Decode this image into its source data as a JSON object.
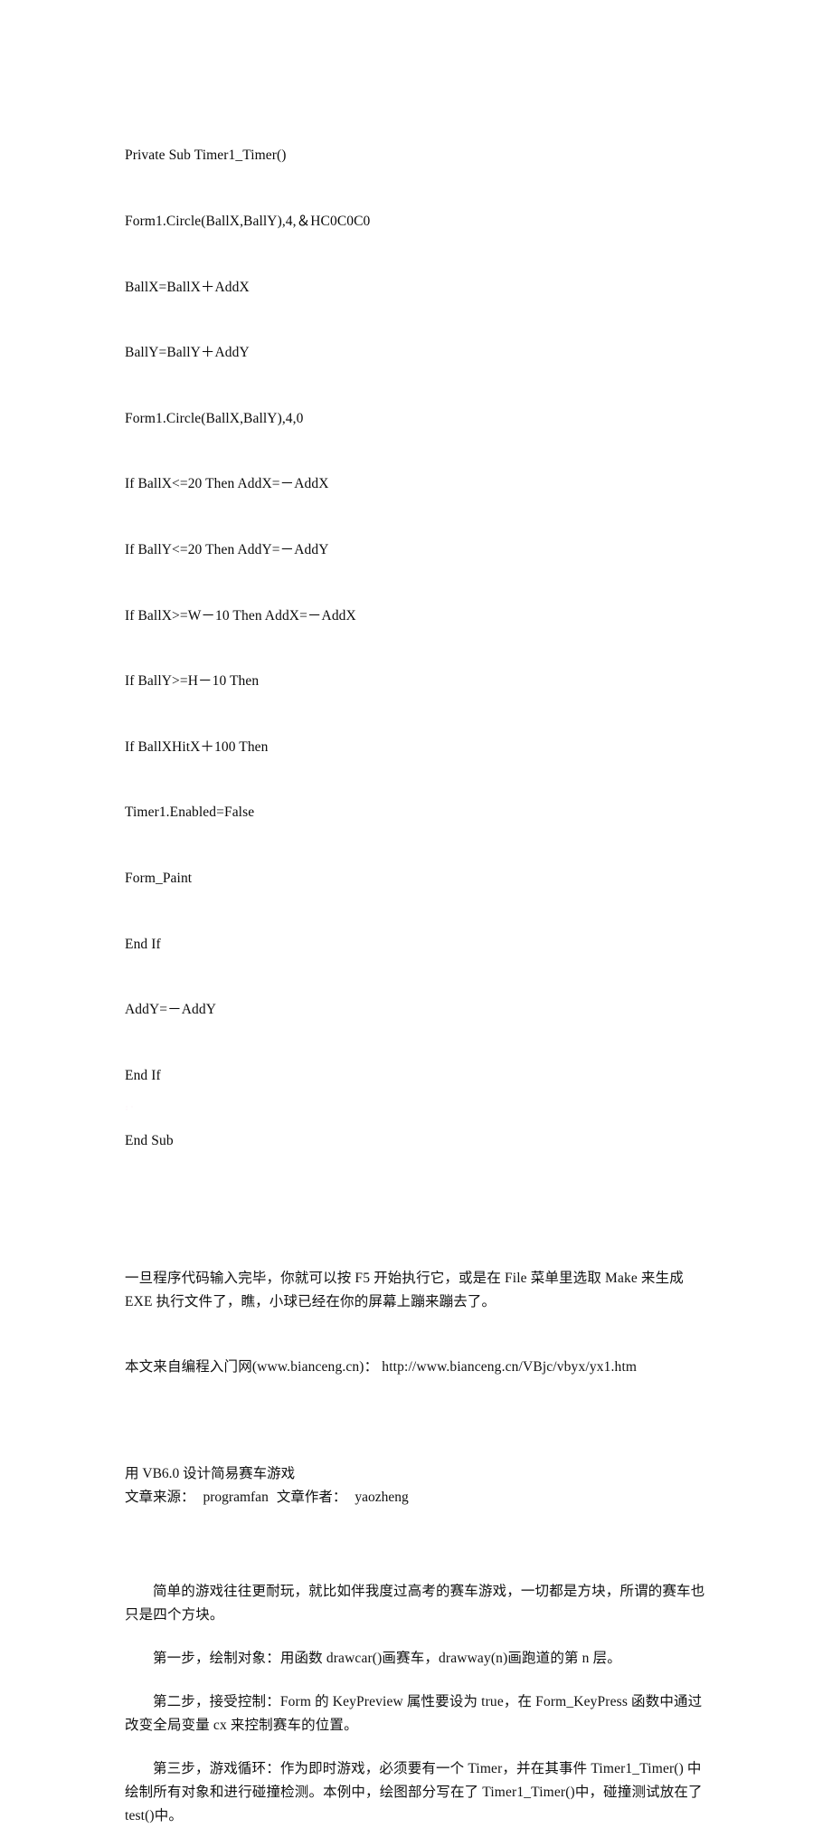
{
  "document": {
    "background_color": "#ffffff",
    "text_color": "#111111"
  },
  "code_block": {
    "language": "Visual Basic",
    "lines": [
      "Private Sub Timer1_Timer()",
      "Form1.Circle(BallX,BallY),4,＆HC0C0C0",
      "BallX=BallX＋AddX",
      "BallY=BallY＋AddY",
      "Form1.Circle(BallX,BallY),4,0",
      "If BallX<=20 Then AddX=－AddX",
      "If BallY<=20 Then AddY=－AddY",
      "If BallX>=W－10 Then AddX=－AddX",
      "If BallY>=H－10 Then",
      "If BallXHitX＋100 Then",
      "Timer1.Enabled=False",
      "Form_Paint",
      "End If",
      "AddY=－AddY",
      "End If",
      "End Sub"
    ]
  },
  "paragraph_run": {
    "text": "一旦程序代码输入完毕，你就可以按 F5 开始执行它，或是在 File 菜单里选取 Make 来生成 EXE 执行文件了，瞧，小球已经在你的屏幕上蹦来蹦去了。"
  },
  "source_line": {
    "text": "本文来自编程入门网(www.bianceng.cn)：  http://www.bianceng.cn/VBjc/vbyx/yx1.htm",
    "site_name": "编程入门网",
    "site_domain": "www.bianceng.cn",
    "url": "http://www.bianceng.cn/VBjc/vbyx/yx1.htm"
  },
  "article": {
    "title": "用 VB6.0 设计简易赛车游戏",
    "byline": {
      "source_label": "文章来源：",
      "source_value": "programfan",
      "author_label": "文章作者：",
      "author_value": "yaozheng"
    },
    "intro": "简单的游戏往往更耐玩，就比如伴我度过高考的赛车游戏，一切都是方块，所谓的赛车也只是四个方块。",
    "steps": [
      "第一步，绘制对象：用函数 drawcar()画赛车，drawway(n)画跑道的第 n 层。",
      "第二步，接受控制：Form 的 KeyPreview 属性要设为 true，在 Form_KeyPress 函数中通过改变全局变量 cx 来控制赛车的位置。",
      "第三步，游戏循环：作为即时游戏，必须要有一个 Timer，并在其事件 Timer1_Timer() 中绘制所有对象和进行碰撞检测。本例中，绘图部分写在了 Timer1_Timer()中，碰撞测试放在了 test()中。"
    ]
  }
}
